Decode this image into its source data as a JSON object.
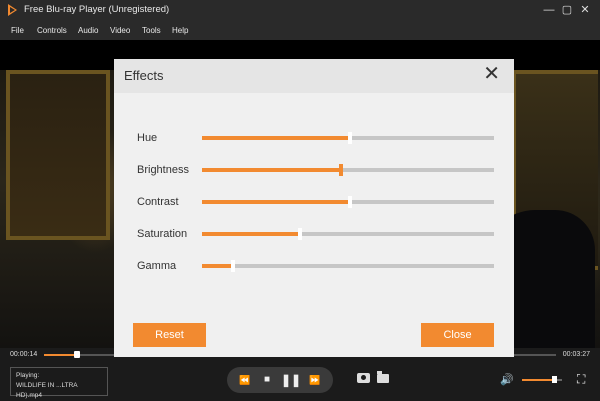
{
  "app": {
    "title": "Free Blu-ray Player (Unregistered)"
  },
  "window_controls": {
    "minimize": "—",
    "maximize": "▢",
    "close": "✕"
  },
  "menu": [
    "File",
    "Controls",
    "Audio",
    "Video",
    "Tools",
    "Help"
  ],
  "dialog": {
    "title": "Effects",
    "close_glyph": "✕",
    "sliders": [
      {
        "label": "Hue",
        "level": 0.5
      },
      {
        "label": "Brightness",
        "level": 0.47
      },
      {
        "label": "Contrast",
        "level": 0.5
      },
      {
        "label": "Saturation",
        "level": 0.33
      },
      {
        "label": "Gamma",
        "level": 0.1
      }
    ],
    "reset_label": "Reset",
    "close_label": "Close"
  },
  "player": {
    "time_current": "00:00:14",
    "time_total": "00:03:27",
    "playing_label": "Playing:",
    "playing_file": "WILDLIFE IN ...LTRA HD).mp4",
    "progress": 0.06,
    "volume": 0.8
  },
  "icons": {
    "rewind": "⏪",
    "stop": "■",
    "pause": "❚❚",
    "forward": "⏩",
    "speaker": "🔊",
    "fullscreen": "⛶"
  },
  "colors": {
    "accent": "#f28a30"
  }
}
